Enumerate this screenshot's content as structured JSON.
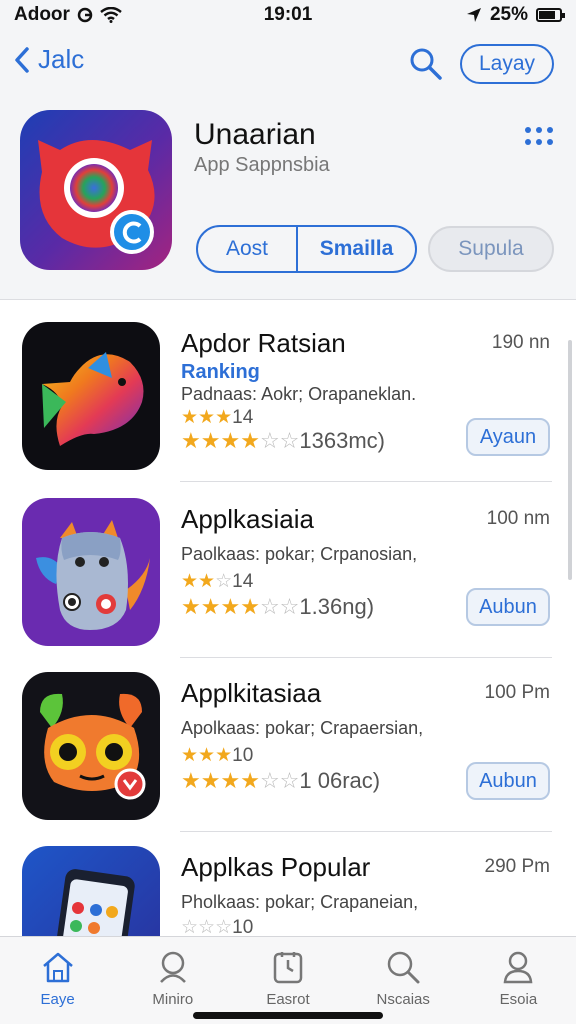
{
  "status": {
    "carrier": "Adoor",
    "time": "19:01",
    "battery": "25%"
  },
  "nav": {
    "back_label": "Jalc",
    "pill_label": "Layay"
  },
  "hero": {
    "title": "Unaarian",
    "subtitle": "App Sappnsbia",
    "segment_left": "Aost",
    "segment_right": "Smailla",
    "right_button": "Supula"
  },
  "apps": [
    {
      "name": "Apdor Ratsian",
      "time": "190 nn",
      "tag": "Ranking",
      "desc": "Padnaas: Aokr; Orapaneklan.",
      "small_stars": 3,
      "small_text": "14",
      "big_stars": 4,
      "big_text": "1363mc)",
      "button": "Ayaun"
    },
    {
      "name": "Applkasiaia",
      "time": "100 nm",
      "tag": "",
      "desc": "Paolkaas: pokar; Crpanosian,",
      "small_stars": 2,
      "small_text": "14",
      "big_stars": 4,
      "big_text": "1.36ng)",
      "button": "Aubun"
    },
    {
      "name": "Applkitasiaa",
      "time": "100 Pm",
      "tag": "",
      "desc": "Apolkaas: pokar; Crapaersian,",
      "small_stars": 3,
      "small_text": "10",
      "big_stars": 4,
      "big_text": "1 06rac)",
      "button": "Aubun"
    },
    {
      "name": "Applkas Popular",
      "time": "290 Pm",
      "tag": "",
      "desc": "Pholkaas: pokar; Crapaneian,",
      "small_stars": 0,
      "small_text": "10",
      "big_stars": 0,
      "big_text": "",
      "button": ""
    }
  ],
  "tabs": [
    {
      "label": "Eaye",
      "icon": "home-icon",
      "active": true
    },
    {
      "label": "Miniro",
      "icon": "profile-icon",
      "active": false
    },
    {
      "label": "Easrot",
      "icon": "clock-icon",
      "active": false
    },
    {
      "label": "Nscaias",
      "icon": "search-icon",
      "active": false
    },
    {
      "label": "Esoia",
      "icon": "user-icon",
      "active": false
    }
  ],
  "colors": {
    "accent": "#2d6fd6",
    "star": "#f2a81d",
    "background_top": "#f4f5f7"
  }
}
